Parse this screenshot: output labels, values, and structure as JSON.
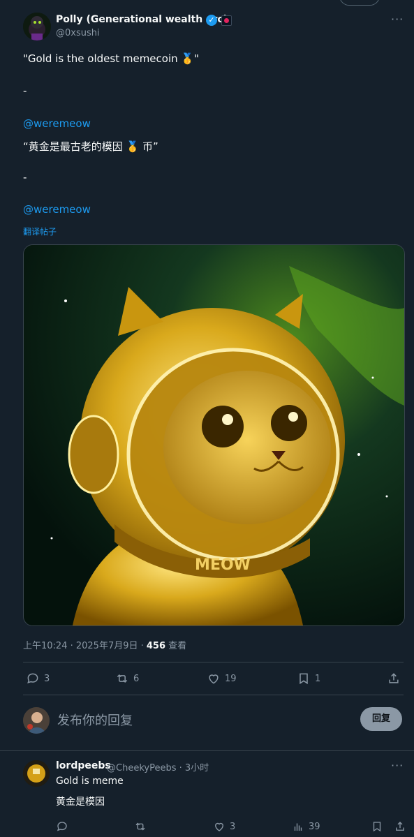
{
  "top_button_label": "...",
  "post": {
    "author_name": "Polly (Generational wealth arc)",
    "author_handle": "@0xsushi",
    "more_label": "···",
    "lines": [
      "\"Gold is the oldest memecoin 🥇\"",
      "-",
      "@weremeow",
      "“黄金是最古老的模因 🥇 币”",
      "-",
      "@weremeow"
    ],
    "translate_label": "翻译帖子",
    "image_alt_text": "MEOW",
    "timestamp": "上午10:24 · 2025年7月9日 · ",
    "views_count": "456",
    "views_label": " 查看"
  },
  "actions": {
    "reply_count": "3",
    "repost_count": "6",
    "like_count": "19",
    "bookmark_count": "1"
  },
  "reply_box": {
    "placeholder": "发布你的回复",
    "button_label": "回复"
  },
  "comment": {
    "author_name": "lordpeebs",
    "author_handle": "@CheekyPeebs · 3小时",
    "more_label": "···",
    "text_line1": "Gold is meme",
    "text_line2": "黄金是模因",
    "like_count": "3",
    "views_count": "39"
  },
  "colors": {
    "background": "#15202b",
    "link": "#1d9bf0",
    "muted": "#8b98a5",
    "gold": "#d9a91c"
  }
}
